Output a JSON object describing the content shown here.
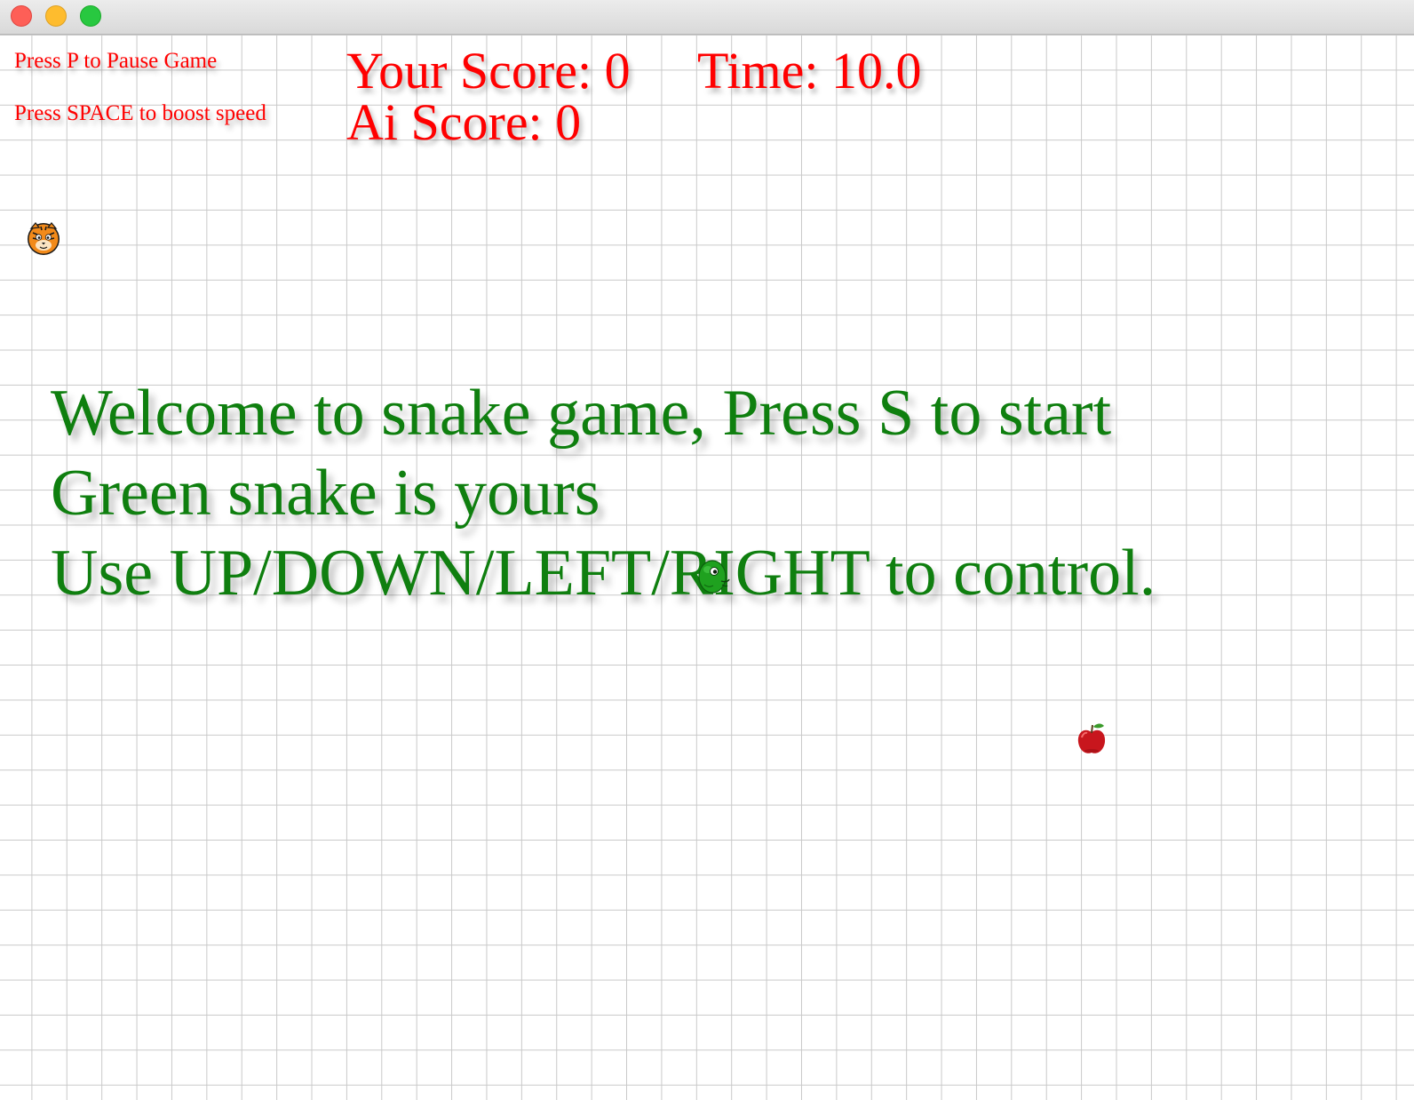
{
  "window": {
    "controls": [
      "close",
      "minimize",
      "zoom"
    ]
  },
  "hud": {
    "pause_hint": "Press P to Pause Game",
    "boost_hint": "Press SPACE to boost speed",
    "your_score": "Your Score: 0",
    "time": "Time: 10.0",
    "ai_score": "Ai Score: 0"
  },
  "welcome": {
    "line1": "Welcome to snake game, Press S to start",
    "line2": "Green snake is yours",
    "line3": "Use UP/DOWN/LEFT/RIGHT to control."
  },
  "colors": {
    "hud_text": "#ff0000",
    "welcome_text": "#0f7f0f",
    "grid_line": "#c9c9c9",
    "player_snake": "#1fa11f",
    "ai_snake": "#f28a1a",
    "apple": "#cc1a1a"
  },
  "sprites": {
    "ai_snake_head": "tiger-face-icon",
    "player_snake_head": "green-snake-head-icon",
    "food": "red-apple-icon"
  }
}
